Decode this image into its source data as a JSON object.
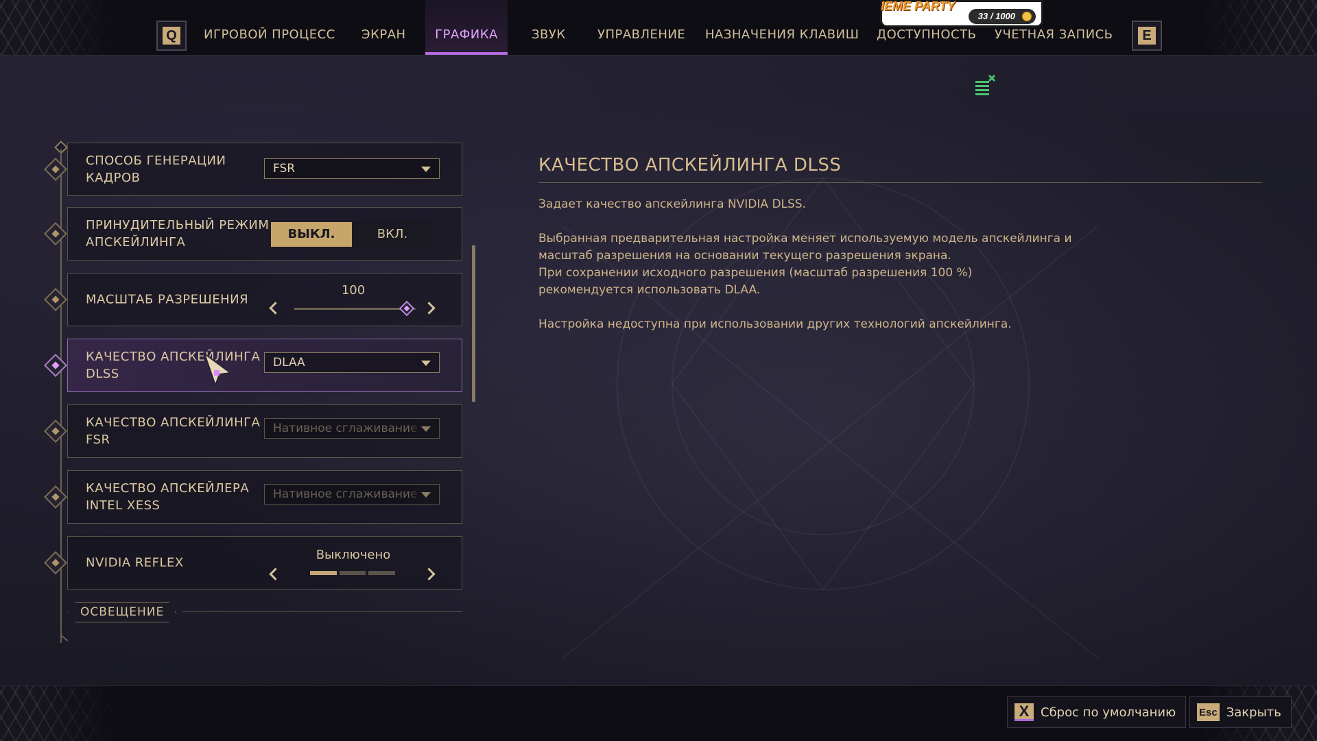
{
  "top_nav": {
    "left_key": "Q",
    "right_key": "E",
    "tabs": [
      {
        "label": "ИГРОВОЙ ПРОЦЕСС",
        "active": false
      },
      {
        "label": "ЭКРАН",
        "active": false
      },
      {
        "label": "ГРАФИКА",
        "active": true
      },
      {
        "label": "ЗВУК",
        "active": false
      },
      {
        "label": "УПРАВЛЕНИЕ",
        "active": false
      },
      {
        "label": "НАЗНАЧЕНИЯ КЛАВИШ",
        "active": false
      },
      {
        "label": "ДОСТУПНОСТЬ",
        "active": false
      },
      {
        "label": "УЧЕТНАЯ ЗАПИСЬ",
        "active": false
      }
    ]
  },
  "event_widget": {
    "title": "IEME PARTY",
    "counter": "33 / 1000"
  },
  "settings": {
    "rows": [
      {
        "label": "СПОСОБ ГЕНЕРАЦИИ КАДРОВ",
        "control": "dropdown",
        "value": "FSR"
      },
      {
        "label": "ПРИНУДИТЕЛЬНЫЙ РЕЖИМ АПСКЕЙЛИНГА",
        "control": "toggle",
        "options": [
          "ВЫКЛ.",
          "ВКЛ."
        ],
        "selected": "ВЫКЛ."
      },
      {
        "label": "МАСШТАБ РАЗРЕШЕНИЯ",
        "control": "slider",
        "value": "100",
        "level": 0.92
      },
      {
        "label": "КАЧЕСТВО АПСКЕЙЛИНГА DLSS",
        "control": "dropdown",
        "value": "DLAA",
        "selected": true
      },
      {
        "label": "КАЧЕСТВО АПСКЕЙЛИНГА FSR",
        "control": "dropdown",
        "value": "Нативное сглаживание",
        "disabled": true
      },
      {
        "label": "КАЧЕСТВО АПСКЕЙЛЕРА INTEL XESS",
        "control": "dropdown",
        "value": "Нативное сглаживание",
        "disabled": true
      },
      {
        "label": "NVIDIA REFLEX",
        "control": "stepper",
        "value": "Выключено",
        "level": 1,
        "steps": 3
      }
    ],
    "section": "ОСВЕЩЕНИЕ"
  },
  "description": {
    "title": "КАЧЕСТВО АПСКЕЙЛИНГА DLSS",
    "line1": "Задает качество апскейлинга NVIDIA DLSS.",
    "line2": "Выбранная предварительная настройка меняет используемую модель апскейлинга и",
    "line3": "масштаб разрешения на основании текущего разрешения экрана.",
    "line4": "При сохранении исходного разрешения (масштаб разрешения 100 %)",
    "line5": "рекомендуется использовать DLAA.",
    "line6": "Настройка недоступна при использовании других технологий апскейлинга."
  },
  "footer": {
    "reset_key": "X",
    "reset_label": "Сброс по умолчанию",
    "close_key": "Esc",
    "close_label": "Закрыть"
  },
  "colors": {
    "accent": "#b36be0",
    "gold": "#c9ab7a",
    "text": "#d9c8a6"
  }
}
